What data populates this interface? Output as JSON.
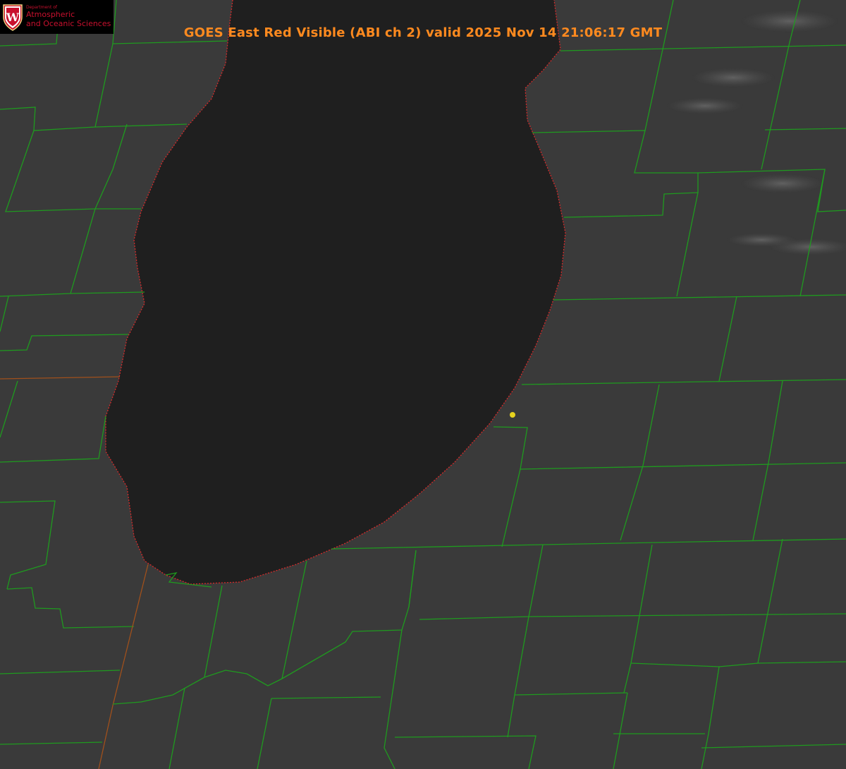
{
  "title": "GOES East Red Visible (ABI ch 2) valid 2025 Nov 14 21:06:17 GMT",
  "logo": {
    "department": "Department of",
    "line1": "Atmospheric",
    "line2": "and Oceanic Sciences",
    "crest_letter": "W"
  },
  "colors": {
    "land": "#3a3a3a",
    "lake": "#1f1f1f",
    "county_lines": "#1f9a1f",
    "shoreline": "#d42a2a",
    "state_line": "#a0501c",
    "title": "#ff8a1f",
    "logo_text": "#c8102e",
    "marker": "#e6d21e"
  },
  "icons": {
    "crest": "uw-crest-icon",
    "marker": "location-marker-icon"
  }
}
